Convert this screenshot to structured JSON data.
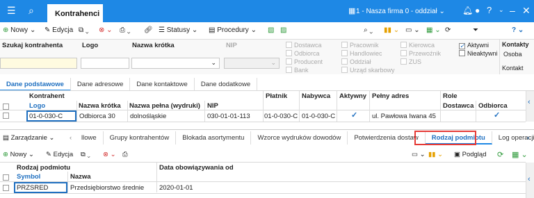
{
  "topbar": {
    "tab_title": "Kontrahenci",
    "company": "1 - Nasza firma 0 - oddział"
  },
  "toolbar": {
    "new": "Nowy",
    "edit": "Edycja",
    "statuses": "Statusy",
    "procedures": "Procedury"
  },
  "filters": {
    "search_label": "Szukaj kontrahenta",
    "logo_label": "Logo",
    "short_name_label": "Nazwa krótka",
    "nip_label": "NIP",
    "roles1": [
      "Dostawca",
      "Odbiorca",
      "Producent",
      "Bank"
    ],
    "roles2": [
      "Pracownik",
      "Handlowiec",
      "Oddział",
      "Urząd skarbowy"
    ],
    "roles3": [
      "Kierowca",
      "Przewoźnik",
      "ZUS"
    ],
    "active": "Aktywni",
    "inactive": "Nieaktywni",
    "side_tabs": [
      "Kontakty",
      "Osoba",
      "Kontakt"
    ]
  },
  "main_tabs": [
    "Dane podstawowe",
    "Dane adresowe",
    "Dane kontaktowe",
    "Dane dodatkowe"
  ],
  "grid": {
    "group_header": "Kontrahent",
    "role_header": "Role",
    "columns": [
      "Logo",
      "Nazwa krótka",
      "Nazwa pełna (wydruki)",
      "NIP",
      "Płatnik",
      "Nabywca",
      "Aktywny",
      "Pełny adres",
      "Dostawca",
      "Odbiorca"
    ],
    "row": {
      "logo": "01-0-030-C",
      "short": "Odbiorca 30",
      "full": "dolnośląskie",
      "nip": "030-01-01-113",
      "payer": "01-0-030-C",
      "buyer": "01-0-030-C",
      "address": "ul. Pawłowa Iwana 45"
    }
  },
  "lower": {
    "manage": "Zarządzanie",
    "tabs": [
      "llowe",
      "Grupy kontrahentów",
      "Blokada asortymentu",
      "Wzorce wydruków dowodów",
      "Potwierdzenia dostaw",
      "Rodzaj podmiotu",
      "Log operacji"
    ],
    "new": "Nowy",
    "edit": "Edycja",
    "preview": "Podgląd"
  },
  "lower_grid": {
    "group_header": "Rodzaj podmiotu",
    "date_header": "Data obowiązywania od",
    "col_symbol": "Symbol",
    "col_name": "Nazwa",
    "row": {
      "symbol": "PRZSRED",
      "name": "Przedsiębiorstwo średnie",
      "date": "2020-01-01"
    }
  }
}
